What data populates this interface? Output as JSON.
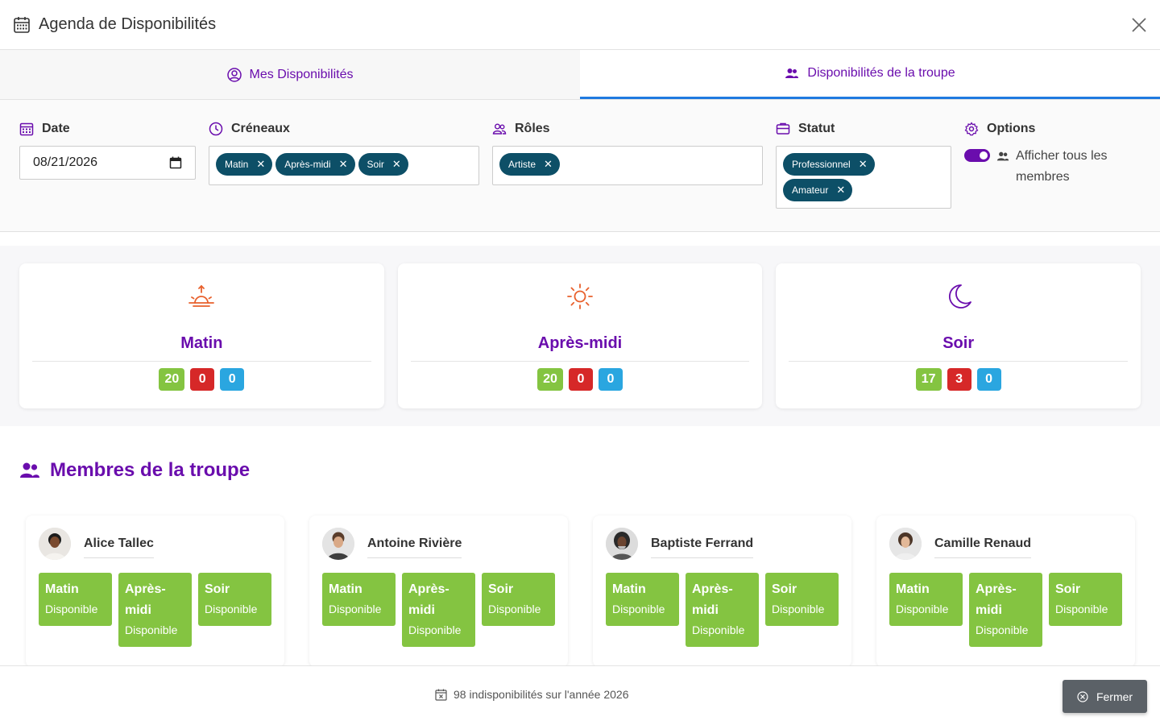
{
  "header": {
    "title": "Agenda de Disponibilités",
    "icon": "calendar-icon",
    "close_icon": "close-icon"
  },
  "tabs": [
    {
      "label": "Mes Disponibilités",
      "icon": "user-circle-icon",
      "active": false
    },
    {
      "label": "Disponibilités de la troupe",
      "icon": "users-icon",
      "active": true
    }
  ],
  "filters": {
    "date": {
      "label": "Date",
      "value": "08/21/2026"
    },
    "creneaux": {
      "label": "Créneaux",
      "chips": [
        "Matin",
        "Après-midi",
        "Soir"
      ]
    },
    "roles": {
      "label": "Rôles",
      "chips": [
        "Artiste"
      ]
    },
    "statut": {
      "label": "Statut",
      "chips": [
        "Professionnel",
        "Amateur"
      ]
    },
    "options": {
      "label": "Options",
      "toggle_label": "Afficher tous les membres",
      "toggle_on": true
    }
  },
  "summary": [
    {
      "name": "Matin",
      "icon": "sunrise-icon",
      "available": "20",
      "unavailable": "0",
      "other": "0"
    },
    {
      "name": "Après-midi",
      "icon": "sun-icon",
      "available": "20",
      "unavailable": "0",
      "other": "0"
    },
    {
      "name": "Soir",
      "icon": "moon-icon",
      "available": "17",
      "unavailable": "3",
      "other": "0"
    }
  ],
  "colors": {
    "accent": "#6a0dad",
    "chip": "#0d4f67",
    "available": "#84c441",
    "unavailable": "#d62828",
    "other": "#2aa6e0",
    "tab_underline": "#1f7ae0"
  },
  "members": {
    "title": "Membres de la troupe",
    "list": [
      {
        "name": "Alice Tallec",
        "slots": [
          {
            "title": "Matin",
            "status": "Disponible"
          },
          {
            "title": "Après-midi",
            "status": "Disponible"
          },
          {
            "title": "Soir",
            "status": "Disponible"
          }
        ]
      },
      {
        "name": "Antoine Rivière",
        "slots": [
          {
            "title": "Matin",
            "status": "Disponible"
          },
          {
            "title": "Après-midi",
            "status": "Disponible"
          },
          {
            "title": "Soir",
            "status": "Disponible"
          }
        ]
      },
      {
        "name": "Baptiste Ferrand",
        "slots": [
          {
            "title": "Matin",
            "status": "Disponible"
          },
          {
            "title": "Après-midi",
            "status": "Disponible"
          },
          {
            "title": "Soir",
            "status": "Disponible"
          }
        ]
      },
      {
        "name": "Camille Renaud",
        "slots": [
          {
            "title": "Matin",
            "status": "Disponible"
          },
          {
            "title": "Après-midi",
            "status": "Disponible"
          },
          {
            "title": "Soir",
            "status": "Disponible"
          }
        ]
      }
    ]
  },
  "footer": {
    "info": "98 indisponibilités sur l'année 2026",
    "close_label": "Fermer"
  }
}
